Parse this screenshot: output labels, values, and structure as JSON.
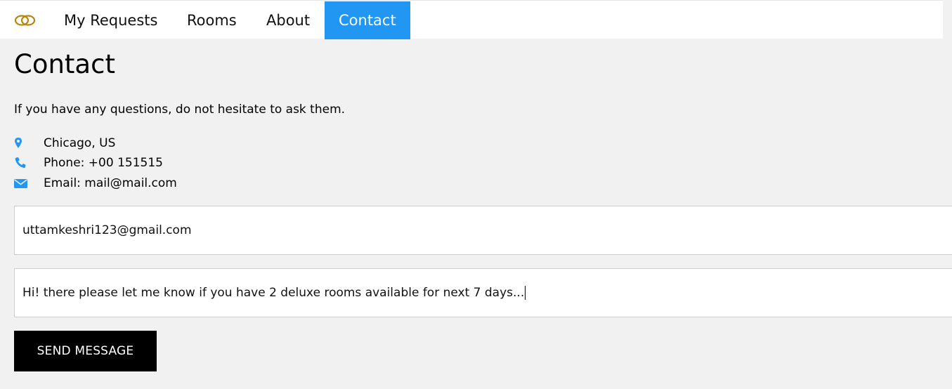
{
  "nav": {
    "logo_icon": "interlocking-rings-icon",
    "items": [
      {
        "label": "My Requests"
      },
      {
        "label": "Rooms"
      },
      {
        "label": "About"
      },
      {
        "label": "Contact",
        "active": true
      }
    ]
  },
  "main": {
    "title": "Contact",
    "intro": "If you have any questions, do not hesitate to ask them.",
    "contacts": [
      {
        "icon": "map-marker-icon",
        "text": "Chicago, US"
      },
      {
        "icon": "phone-icon",
        "text": "Phone: +00 151515"
      },
      {
        "icon": "envelope-icon",
        "text": "Email: mail@mail.com"
      }
    ]
  },
  "form": {
    "email_value": "uttamkeshri123@gmail.com",
    "message_value": "Hi! there please let me know if you have 2 deluxe rooms available for next 7 days...",
    "submit_label": "SEND MESSAGE"
  },
  "colors": {
    "accent": "#2196f3",
    "logo": "#b8860b",
    "background": "#f1f1f1",
    "button": "#000000"
  }
}
